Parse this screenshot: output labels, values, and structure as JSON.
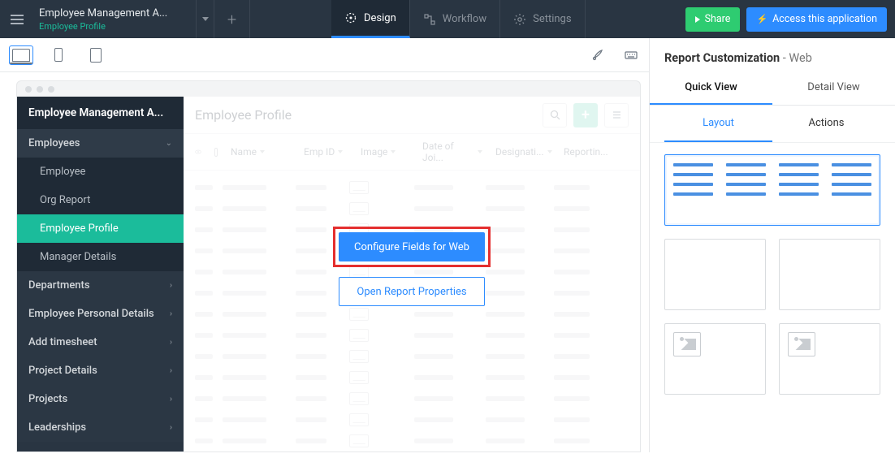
{
  "header": {
    "app_title": "Employee Management A...",
    "app_subtitle": "Employee Profile",
    "tabs": {
      "design": "Design",
      "workflow": "Workflow",
      "settings": "Settings"
    },
    "share_label": "Share",
    "access_label": "Access this application"
  },
  "sidebar": {
    "app_name": "Employee Management A...",
    "items": [
      {
        "label": "Employees",
        "type": "parent",
        "expanded": true
      },
      {
        "label": "Employee",
        "type": "child"
      },
      {
        "label": "Org Report",
        "type": "child"
      },
      {
        "label": "Employee Profile",
        "type": "child",
        "active": true
      },
      {
        "label": "Manager Details",
        "type": "child"
      },
      {
        "label": "Departments",
        "type": "parent"
      },
      {
        "label": "Employee Personal Details",
        "type": "parent"
      },
      {
        "label": "Add timesheet",
        "type": "parent"
      },
      {
        "label": "Project Details",
        "type": "parent"
      },
      {
        "label": "Projects",
        "type": "parent"
      },
      {
        "label": "Leaderships",
        "type": "parent"
      }
    ]
  },
  "report": {
    "title": "Employee Profile",
    "columns": {
      "name": "Name",
      "emp_id": "Emp ID",
      "image": "Image",
      "date": "Date of Joi...",
      "designation": "Designati...",
      "reporting": "Reportin..."
    }
  },
  "overlay": {
    "configure_label": "Configure Fields for Web",
    "open_props_label": "Open Report Properties"
  },
  "right_panel": {
    "title_main": "Report Customization",
    "title_suffix": " - Web",
    "view_tabs": {
      "quick": "Quick View",
      "detail": "Detail View"
    },
    "sub_tabs": {
      "layout": "Layout",
      "actions": "Actions"
    }
  }
}
